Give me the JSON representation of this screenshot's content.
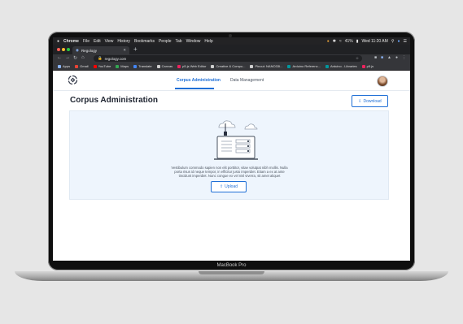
{
  "device": {
    "label": "MacBook Pro"
  },
  "menubar": {
    "apple": "",
    "items": [
      "Chrome",
      "File",
      "Edit",
      "View",
      "History",
      "Bookmarks",
      "People",
      "Tab",
      "Window",
      "Help"
    ],
    "battery": "41%",
    "clock": "Wed 11:20 AM"
  },
  "browser": {
    "tab_title": "Regology",
    "url": "regology.com",
    "bookmarks": [
      {
        "label": "Apps",
        "color": "#8ab4f8"
      },
      {
        "label": "Gmail",
        "color": "#ea4335"
      },
      {
        "label": "YouTube",
        "color": "#ff0000"
      },
      {
        "label": "Maps",
        "color": "#34a853"
      },
      {
        "label": "Translate",
        "color": "#4285f4"
      },
      {
        "label": "Canvas",
        "color": "#cfcfcf"
      },
      {
        "label": "p5.js Web Editor",
        "color": "#ed225d"
      },
      {
        "label": "Creative & Compu...",
        "color": "#cfcfcf"
      },
      {
        "label": "Pinout: NANO33I...",
        "color": "#cfcfcf"
      },
      {
        "label": "Arduino Referenc...",
        "color": "#00979d"
      },
      {
        "label": "Arduino - Libraries",
        "color": "#00979d"
      },
      {
        "label": "p5.js",
        "color": "#ed225d"
      }
    ]
  },
  "app": {
    "nav": {
      "active": "Corpus Administration",
      "other": "Data Management"
    },
    "title": "Corpus Administration",
    "download_label": "Download",
    "description": "Vestibulum commodo sapien non elit porttitor, vitae volutpat nibh mollis. Nulla porta risus id neque tempor, in efficitur justo imperdiet. Etiam a ex at ante tincidunt imperdiet. Nunc congue ex vel nisl viverra, sit amet aliquet",
    "upload_label": "Upload",
    "colors": {
      "accent": "#1f6fd6",
      "panel": "#eef5fd"
    }
  }
}
